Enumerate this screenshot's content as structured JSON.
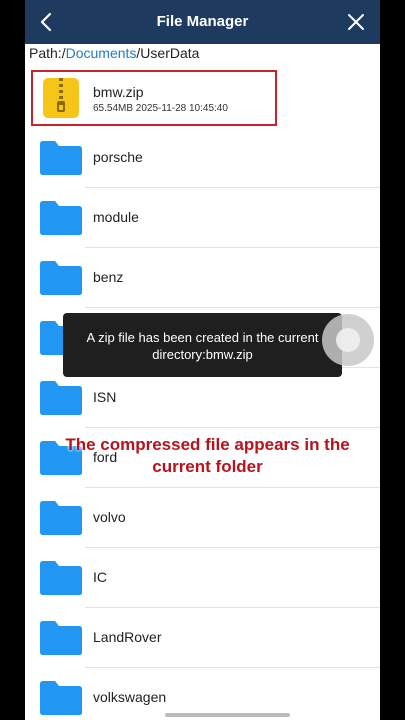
{
  "header": {
    "title": "File Manager"
  },
  "path": {
    "prefix": "Path:/",
    "link": "Documents",
    "suffix": "/UserData"
  },
  "zip_item": {
    "name": "bmw.zip",
    "meta": "65.54MB 2025-11-28 10:45:40"
  },
  "folders": [
    "porsche",
    "module",
    "benz",
    "",
    "ISN",
    "ford",
    "volvo",
    "IC",
    "LandRover",
    "volkswagen"
  ],
  "toast": {
    "line1": "A zip file has been created in the current",
    "line2": "directory:bmw.zip"
  },
  "caption": {
    "line1": "The compressed file appears in the",
    "line2": "current folder"
  },
  "colors": {
    "header_bg": "#1e3a5f",
    "folder": "#2196f3",
    "zip": "#f5c518",
    "highlight": "#c8232c",
    "link": "#1e7cc0"
  }
}
